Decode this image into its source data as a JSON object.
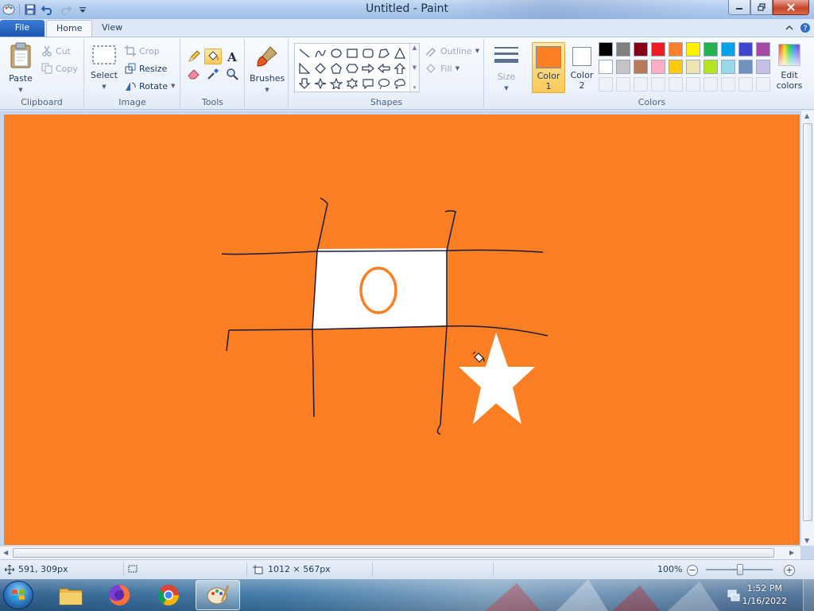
{
  "window": {
    "title": "Untitled - Paint",
    "minimize_icon": "minimize-icon",
    "restore_icon": "restore-icon",
    "close_icon": "close-icon"
  },
  "quick_access": [
    "paint-menu-icon",
    "save-icon",
    "undo-icon",
    "redo-icon",
    "customize-arrow-icon"
  ],
  "tabs": {
    "file": "File",
    "home": "Home",
    "view": "View"
  },
  "ribbon": {
    "clipboard": {
      "group": "Clipboard",
      "paste": "Paste",
      "cut": "Cut",
      "copy": "Copy"
    },
    "image": {
      "group": "Image",
      "select": "Select",
      "crop": "Crop",
      "resize": "Resize",
      "rotate": "Rotate"
    },
    "tools": {
      "group": "Tools",
      "active_tool": "fill-bucket",
      "items": [
        "pencil",
        "fill-bucket",
        "text",
        "eraser",
        "color-picker",
        "magnifier"
      ]
    },
    "brushes": {
      "label": "Brushes"
    },
    "shapes": {
      "group": "Shapes",
      "outline": "Outline",
      "fill": "Fill",
      "items": [
        "line",
        "curve",
        "oval",
        "rectangle",
        "rounded-rectangle",
        "polygon",
        "triangle",
        "right-triangle",
        "diamond",
        "pentagon",
        "hexagon",
        "right-arrow",
        "left-arrow",
        "up-arrow",
        "down-arrow",
        "four-point-star",
        "five-point-star",
        "six-point-star",
        "rounded-callout",
        "oval-callout",
        "cloud-callout"
      ]
    },
    "size": {
      "label": "Size"
    },
    "colors": {
      "group": "Colors",
      "color1_label": "Color",
      "color1_num": "1",
      "color2_label": "Color",
      "color2_num": "2",
      "color1": "#fd7f23",
      "color2": "#ffffff",
      "edit_colors_line1": "Edit",
      "edit_colors_line2": "colors",
      "palette": [
        "#000000",
        "#7f7f7f",
        "#880015",
        "#ed1c24",
        "#ff7f27",
        "#fff200",
        "#22b14c",
        "#00a2e8",
        "#3f48cc",
        "#a349a4",
        "#ffffff",
        "#c3c3c3",
        "#b97a57",
        "#ffaec9",
        "#ffc90e",
        "#efe4b0",
        "#b5e61d",
        "#99d9ea",
        "#7092be",
        "#c8bfe7",
        "",
        "",
        "",
        "",
        "",
        "",
        "",
        "",
        "",
        ""
      ]
    }
  },
  "canvas": {
    "background": "#fd7f23",
    "drawing": [
      "tic-tac-toe-grid",
      "white-filled-cell",
      "letter-o",
      "white-star",
      "fill-bucket-cursor"
    ]
  },
  "status": {
    "cursor_position": "591, 309px",
    "canvas_size": "1012 × 567px",
    "zoom": "100%",
    "zoom_level": 1.0
  },
  "taskbar": {
    "apps": [
      "start-button",
      "file-explorer",
      "firefox",
      "chrome",
      "paint"
    ],
    "time": "1:52 PM",
    "date": "1/16/2022"
  }
}
